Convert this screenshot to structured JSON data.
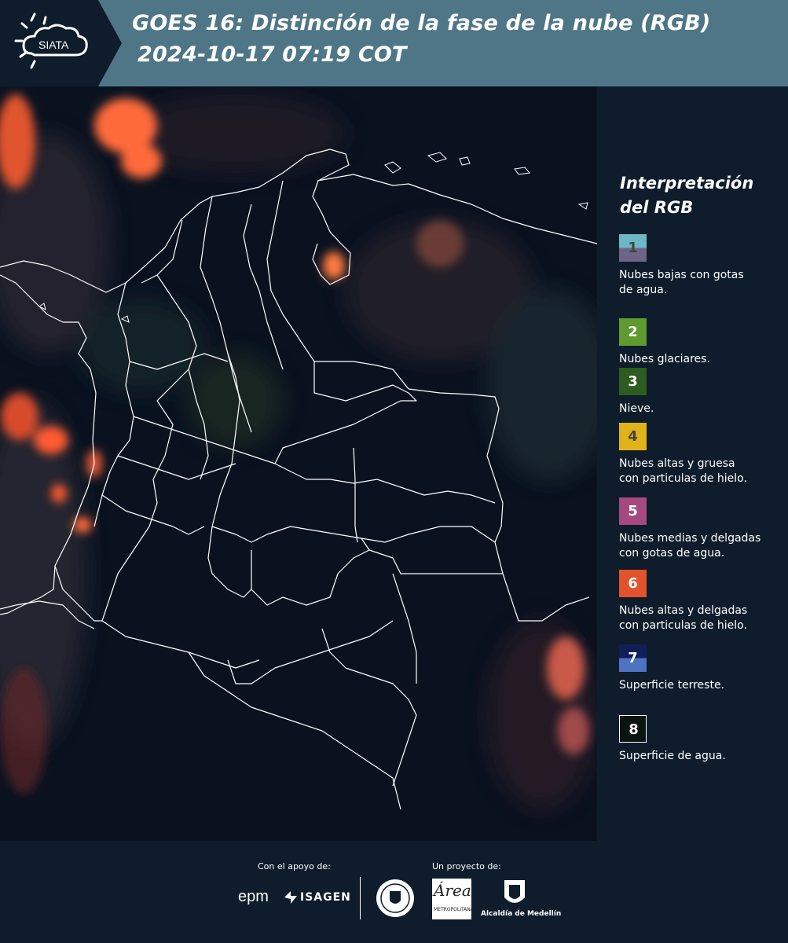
{
  "header": {
    "logo_text": "SIATA",
    "title_line1": "GOES 16: Distinción de la fase de la nube (RGB)",
    "title_line2": "2024-10-17 07:19 COT",
    "background_color": "#4e7686"
  },
  "map": {
    "background_color": "#0a1220",
    "border_color": "#ffffff"
  },
  "legend": {
    "title_line1": "Interpretación",
    "title_line2": "del RGB",
    "items": [
      {
        "number": "1",
        "label_line1": "Nubes bajas con gotas",
        "label_line2": "de agua.",
        "color_top": "#6cb8c4",
        "color_bottom": "#6e6486",
        "number_color": "#444444"
      },
      {
        "number": "2",
        "label_line1": "Nubes glaciares.",
        "label_line2": "",
        "color_top": "#5f9a2e",
        "color_bottom": "#5f9a2e",
        "number_color": "#ffffff"
      },
      {
        "number": "3",
        "label_line1": "Nieve.",
        "label_line2": "",
        "color_top": "#2e5b1f",
        "color_bottom": "#2e5b1f",
        "number_color": "#ffffff"
      },
      {
        "number": "4",
        "label_line1": "Nubes altas y gruesa",
        "label_line2": "con particulas de hielo.",
        "color_top": "#e0b31a",
        "color_bottom": "#e0b31a",
        "number_color": "#444444"
      },
      {
        "number": "5",
        "label_line1": "Nubes medias y delgadas",
        "label_line2": "con gotas de agua.",
        "color_top": "#a54a80",
        "color_bottom": "#a54a80",
        "number_color": "#ffffff"
      },
      {
        "number": "6",
        "label_line1": "Nubes altas y delgadas",
        "label_line2": "con particulas de hielo.",
        "color_top": "#e2522c",
        "color_bottom": "#e2522c",
        "number_color": "#ffffff"
      },
      {
        "number": "7",
        "label_line1": "Superficie terreste.",
        "label_line2": "",
        "color_top": "#101f5a",
        "color_bottom": "#4d73c2",
        "number_color": "#ffffff"
      },
      {
        "number": "8",
        "label_line1": "Superficie de agua.",
        "label_line2": "",
        "color_top": "#0a1410",
        "color_bottom": "#0a1410",
        "number_color": "#ffffff"
      }
    ]
  },
  "footer": {
    "support_label": "Con el apoyo de:",
    "project_label": "Un proyecto de:",
    "epm_text": "epm",
    "isagen_text": "ISAGEN",
    "area_text": "Área",
    "area_sub": "METROPOLITANA",
    "medellin_text": "Alcaldía de Medellín"
  }
}
